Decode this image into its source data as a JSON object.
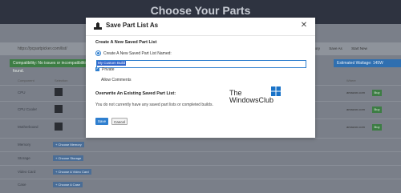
{
  "background": {
    "page_title": "Choose Your Parts",
    "url_text": "https://pcpartpicker.com/list/",
    "compatibility_text": "Compatibility: No issues or incompatibilities found.",
    "wattage_text": "Estimated Wattage: 145W",
    "toolbar_buttons": [
      "History",
      "Save As",
      "Start New"
    ],
    "column_headers": [
      "Component",
      "Selection",
      "Where"
    ],
    "rows": [
      {
        "label": "CPU",
        "merchant": "amazon.com",
        "buy": "Buy"
      },
      {
        "label": "CPU Cooler",
        "merchant": "amazon.com",
        "buy": "Buy"
      },
      {
        "label": "Motherboard",
        "merchant": "amazon.com",
        "buy": "Buy"
      },
      {
        "label": "Memory",
        "choose": "+ Choose Memory"
      },
      {
        "label": "Storage",
        "choose": "+ Choose Storage"
      },
      {
        "label": "Video Card",
        "choose": "+ Choose A Video Card"
      },
      {
        "label": "Case",
        "choose": "+ Choose A Case"
      }
    ]
  },
  "modal": {
    "title": "Save Part List As",
    "section_new_heading": "Create A New Saved Part List",
    "radio_label": "Create A New Saved Part List Named:",
    "name_value": "My Custom Build",
    "private_label": "Private",
    "allow_comments_label": "Allow Comments",
    "section_overwrite_heading": "Overwrite An Existing Saved Part List:",
    "no_lists_message": "You do not currently have any saved part lists or completed builds.",
    "save_label": "Save",
    "cancel_label": "Cancel"
  },
  "watermark": {
    "line1": "The",
    "line2": "WindowsClub"
  },
  "colors": {
    "accent": "#2f7fcf",
    "compat_green": "#3d7d44",
    "wattage_blue": "#2f6fb0"
  }
}
